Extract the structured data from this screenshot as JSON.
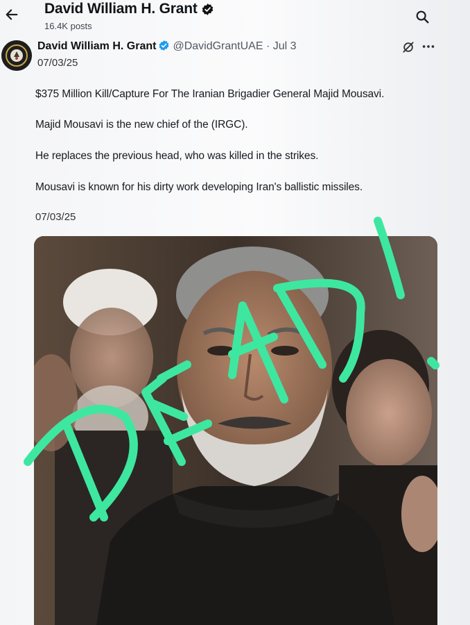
{
  "header": {
    "title": "David William H. Grant",
    "posts_count": "16.4K posts"
  },
  "post": {
    "author_name": "David William H. Grant",
    "handle": "@DavidGrantUAE",
    "separator": "·",
    "time": "Jul 3",
    "date_line": "07/03/25",
    "lines": [
      "$375 Million Kill/Capture For The Iranian Brigadier General Majid Mousavi.",
      "Majid Mousavi is the new chief of the (IRGC).",
      "He replaces the previous head, who was killed in the strikes.",
      "Mousavi is known for his dirty work developing Iran's ballistic missiles."
    ],
    "footer_date": "07/03/25",
    "overlay_text": "DEAD!.",
    "overlay_color": "#3ee7a0",
    "verified_color": "#1d9bf0"
  }
}
